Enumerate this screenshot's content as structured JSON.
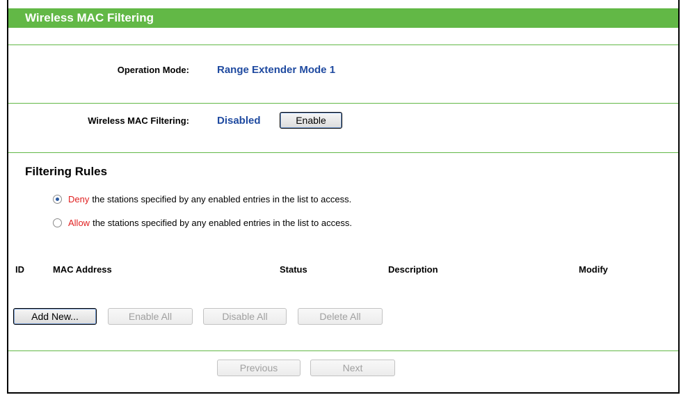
{
  "page": {
    "title": "Wireless MAC Filtering"
  },
  "operation": {
    "label": "Operation Mode:",
    "value": "Range Extender Mode 1"
  },
  "filtering": {
    "label": "Wireless MAC Filtering:",
    "value": "Disabled",
    "button_label": "Enable"
  },
  "rules": {
    "title": "Filtering Rules",
    "options": [
      {
        "keyword": "Deny",
        "text": "the stations specified by any enabled entries in the list to access.",
        "checked": true
      },
      {
        "keyword": "Allow",
        "text": "the stations specified by any enabled entries in the list to access.",
        "checked": false
      }
    ]
  },
  "table": {
    "columns": [
      "ID",
      "MAC Address",
      "Status",
      "Description",
      "Modify"
    ],
    "rows": []
  },
  "actions": {
    "add_new": "Add New...",
    "enable_all": "Enable All",
    "disable_all": "Disable All",
    "delete_all": "Delete All"
  },
  "pagination": {
    "previous": "Previous",
    "next": "Next"
  },
  "colors": {
    "accent": "#62b846",
    "value_blue": "#1f4aa0",
    "keyword_red": "#e02020"
  }
}
